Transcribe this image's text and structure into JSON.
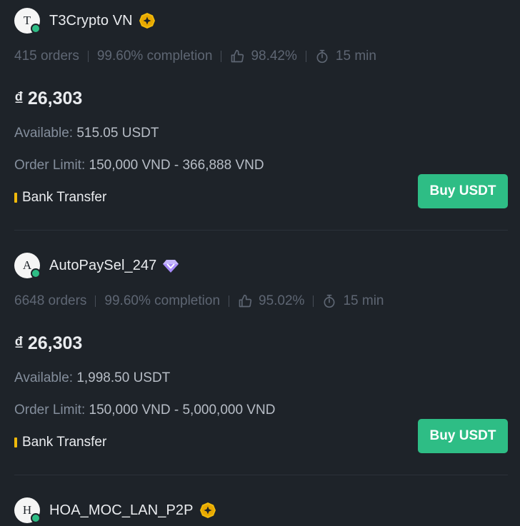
{
  "colors": {
    "background": "#1e2329",
    "buy_button": "#2ebd85",
    "online": "#2ebd85",
    "payment_bar": "#f0b90b",
    "muted_text": "#5e6673",
    "label_text": "#848e9c"
  },
  "ads": [
    {
      "avatar_letter": "T",
      "merchant": "T3Crypto VN",
      "badge_icon": "gold-merchant-badge-icon",
      "orders": "415 orders",
      "completion": "99.60% completion",
      "like_icon": "thumbs-up-icon",
      "rating": "98.42%",
      "timer_icon": "stopwatch-icon",
      "time": "15 min",
      "currency_symbol": "₫",
      "price": "26,303",
      "available_label": "Available:",
      "available_value": "515.05 USDT",
      "limit_label": "Order Limit:",
      "limit_value": "150,000 VND - 366,888 VND",
      "payment_method": "Bank Transfer",
      "button_label": "Buy USDT"
    },
    {
      "avatar_letter": "A",
      "merchant": "AutoPaySel_247",
      "badge_icon": "diamond-merchant-badge-icon",
      "orders": "6648 orders",
      "completion": "99.60% completion",
      "like_icon": "thumbs-up-icon",
      "rating": "95.02%",
      "timer_icon": "stopwatch-icon",
      "time": "15 min",
      "currency_symbol": "₫",
      "price": "26,303",
      "available_label": "Available:",
      "available_value": "1,998.50 USDT",
      "limit_label": "Order Limit:",
      "limit_value": "150,000 VND - 5,000,000 VND",
      "payment_method": "Bank Transfer",
      "button_label": "Buy USDT"
    },
    {
      "avatar_letter": "H",
      "merchant": "HOA_MOC_LAN_P2P",
      "badge_icon": "gold-merchant-badge-icon"
    }
  ]
}
